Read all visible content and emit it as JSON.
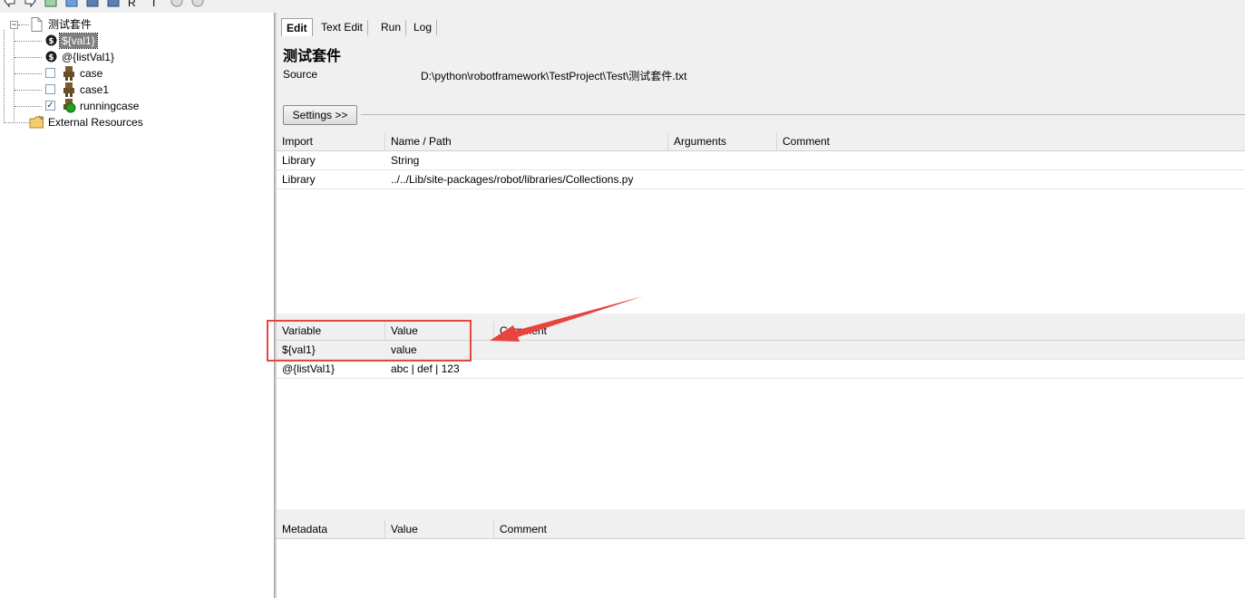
{
  "toolbar": {
    "fragment_1": "R",
    "fragment_2": "T"
  },
  "tree": {
    "root": {
      "label": "测试套件"
    },
    "items": [
      {
        "label": "${val1}",
        "type": "scalar-variable",
        "selected": true
      },
      {
        "label": "@{listVal1}",
        "type": "list-variable"
      },
      {
        "label": "case",
        "type": "test-case",
        "checked": false
      },
      {
        "label": "case1",
        "type": "test-case",
        "checked": false
      },
      {
        "label": "runningcase",
        "type": "test-case",
        "checked": true,
        "running": true
      }
    ],
    "external_resources": {
      "label": "External Resources"
    }
  },
  "tabs": [
    {
      "label": "Edit",
      "active": true
    },
    {
      "label": "Text Edit"
    },
    {
      "label": "Run"
    },
    {
      "label": "Log"
    }
  ],
  "suite": {
    "title": "测试套件",
    "source_label": "Source",
    "source_path": "D:\\python\\robotframework\\TestProject\\Test\\测试套件.txt"
  },
  "settings_button": "Settings >>",
  "imports": {
    "headers": [
      "Import",
      "Name / Path",
      "Arguments",
      "Comment"
    ],
    "rows": [
      [
        "Library",
        "String",
        "",
        ""
      ],
      [
        "Library",
        "../../Lib/site-packages/robot/libraries/Collections.py",
        "",
        ""
      ]
    ]
  },
  "variables": {
    "headers": [
      "Variable",
      "Value",
      "Comment"
    ],
    "rows": [
      [
        "${val1}",
        "value",
        ""
      ],
      [
        "@{listVal1}",
        "abc | def | 123",
        ""
      ]
    ]
  },
  "metadata": {
    "headers": [
      "Metadata",
      "Value",
      "Comment"
    ],
    "rows": []
  },
  "colors": {
    "annotation": "#e8443e",
    "selection": "#808080",
    "panel": "#f0f0f0"
  }
}
